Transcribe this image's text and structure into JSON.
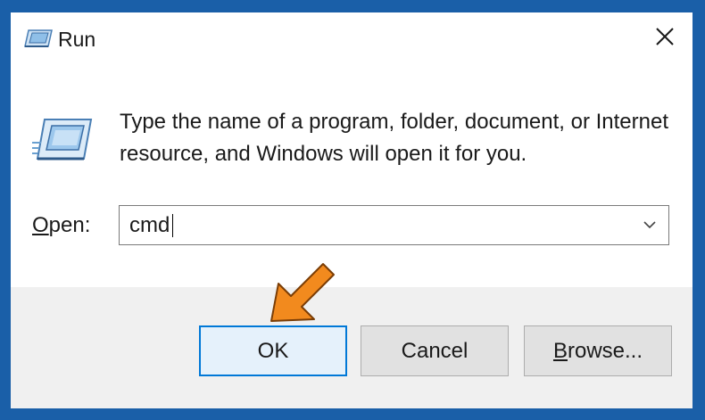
{
  "window": {
    "title": "Run",
    "title_icon": "run-icon",
    "close_icon": "close-icon"
  },
  "dialog": {
    "description": "Type the name of a program, folder, document, or Internet resource, and Windows will open it for you.",
    "open_label_accel": "O",
    "open_label_rest": "pen:",
    "input_value": "cmd",
    "dropdown_icon": "chevron-down-icon"
  },
  "buttons": {
    "ok": "OK",
    "cancel": "Cancel",
    "browse_accel": "B",
    "browse_rest": "rowse..."
  },
  "annotation": {
    "pointer_icon": "arrow-pointer-icon",
    "color": "#f28a1e"
  },
  "colors": {
    "background": "#1a5fa8",
    "accent": "#0078d7",
    "footer": "#f0f0f0"
  }
}
